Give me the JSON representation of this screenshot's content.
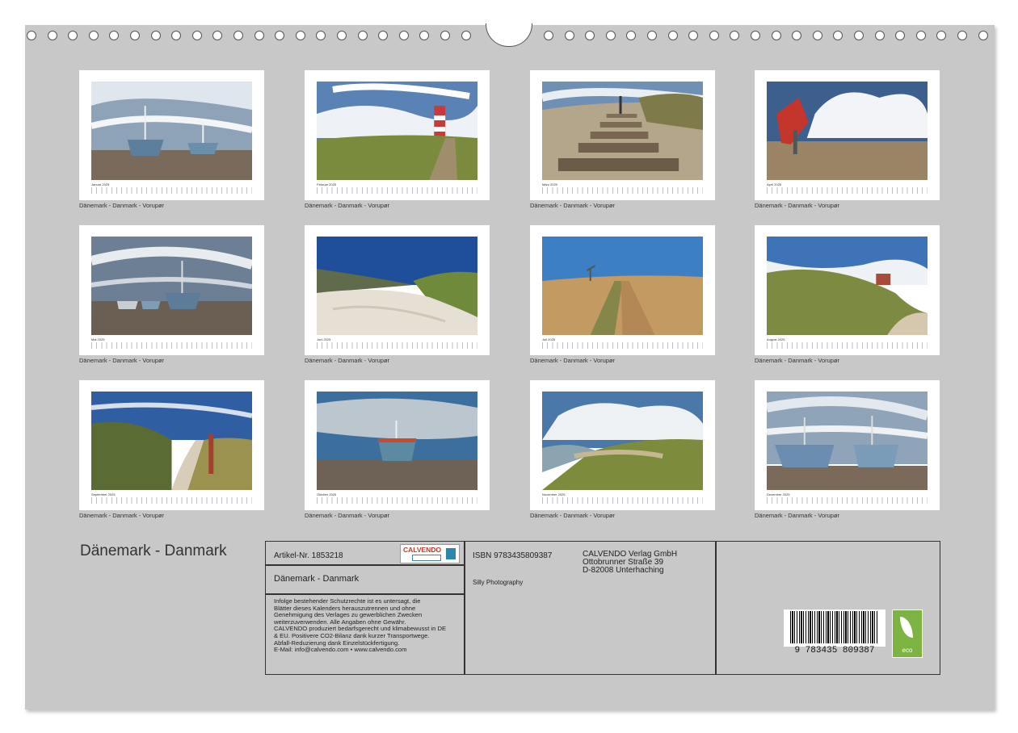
{
  "months": [
    {
      "label": "Januar 2025",
      "caption": "Dänemark - Danmark - Vorupør"
    },
    {
      "label": "Februar 2025",
      "caption": "Dänemark - Danmark - Vorupør"
    },
    {
      "label": "März 2025",
      "caption": "Dänemark - Danmark - Vorupør"
    },
    {
      "label": "April 2025",
      "caption": "Dänemark - Danmark - Vorupør"
    },
    {
      "label": "Mai 2025",
      "caption": "Dänemark - Danmark - Vorupør"
    },
    {
      "label": "Juni 2025",
      "caption": "Dänemark - Danmark - Vorupør"
    },
    {
      "label": "Juli 2025",
      "caption": "Dänemark - Danmark - Vorupør"
    },
    {
      "label": "August 2025",
      "caption": "Dänemark - Danmark - Vorupør"
    },
    {
      "label": "September 2025",
      "caption": "Dänemark - Danmark - Vorupør"
    },
    {
      "label": "Oktober 2025",
      "caption": "Dänemark - Danmark - Vorupør"
    },
    {
      "label": "November 2025",
      "caption": "Dänemark - Danmark - Vorupør"
    },
    {
      "label": "Dezember 2025",
      "caption": "Dänemark - Danmark - Vorupør"
    }
  ],
  "title": "Dänemark - Danmark",
  "info": {
    "article": "Artikel-Nr. 1853218",
    "logo": "CALVENDO",
    "calendar_title": "Dänemark - Danmark",
    "isbn": "ISBN 9783435809387",
    "author": "Silly Photography",
    "publisher_1": "CALVENDO Verlag GmbH",
    "publisher_2": "Ottobrunner Straße 39",
    "publisher_3": "D-82008 Unterhaching",
    "legal_1": "Infolge bestehender Schutzrechte ist es untersagt, die",
    "legal_2": "Blätter dieses Kalenders herauszutrennen und ohne",
    "legal_3": "Genehmigung des Verlages zu gewerblichen Zwecken",
    "legal_4": "weiterzuverwenden. Alle Angaben ohne Gewähr.",
    "legal_5": "CALVENDO produziert bedarfsgerecht und klimabewusst in DE",
    "legal_6": "& EU. Positivere CO2-Bilanz dank kurzer Transportwege.",
    "legal_7": "Abfall-Reduzierung dank Einzelstückfertigung.",
    "legal_8": "E-Mail: info@calvendo.com • www.calvendo.com",
    "barcode_number": "9 783435 809387",
    "eco_label": "eco"
  },
  "colors": {
    "sheet": "#c8c8c8",
    "eco": "#7cb342",
    "accent": "#c0392b"
  },
  "icons": [
    "calvendo-logo-icon",
    "barcode-icon",
    "eco-leaf-icon"
  ]
}
